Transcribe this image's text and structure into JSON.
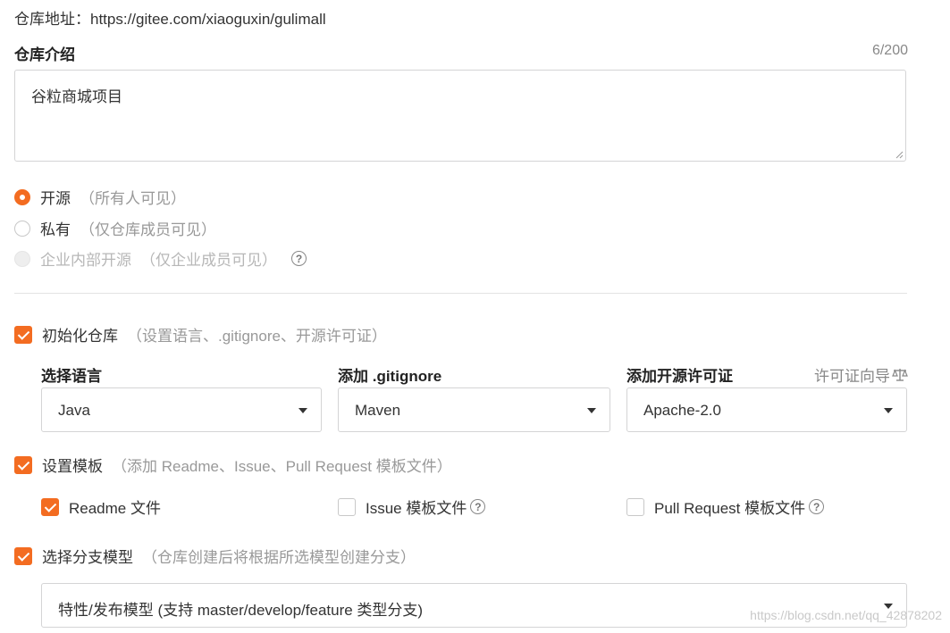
{
  "repo": {
    "address_label": "仓库地址：",
    "address_value": "https://gitee.com/xiaoguxin/gulimall"
  },
  "description": {
    "label": "仓库介绍",
    "count": "6/200",
    "value": "谷粒商城项目"
  },
  "visibility": {
    "options": [
      {
        "label": "开源",
        "hint": "（所有人可见）",
        "checked": true,
        "disabled": false
      },
      {
        "label": "私有",
        "hint": "（仅仓库成员可见）",
        "checked": false,
        "disabled": false
      },
      {
        "label": "企业内部开源",
        "hint": "（仅企业成员可见）",
        "checked": false,
        "disabled": true
      }
    ]
  },
  "init_repo": {
    "label": "初始化仓库",
    "hint": "（设置语言、.gitignore、开源许可证）",
    "checked": true
  },
  "selects": {
    "language": {
      "label": "选择语言",
      "value": "Java"
    },
    "gitignore": {
      "label": "添加 .gitignore",
      "value": "Maven"
    },
    "license": {
      "label": "添加开源许可证",
      "value": "Apache-2.0",
      "guide": "许可证向导"
    }
  },
  "template": {
    "label": "设置模板",
    "hint": "（添加 Readme、Issue、Pull Request 模板文件）",
    "checked": true,
    "options": [
      {
        "label": "Readme 文件",
        "checked": true
      },
      {
        "label": "Issue 模板文件",
        "checked": false
      },
      {
        "label": "Pull Request 模板文件",
        "checked": false
      }
    ]
  },
  "branch_model": {
    "label": "选择分支模型",
    "hint": "（仓库创建后将根据所选模型创建分支）",
    "checked": true,
    "value": "特性/发布模型 (支持 master/develop/feature 类型分支)"
  },
  "watermark": "https://blog.csdn.net/qq_42878202",
  "colors": {
    "accent": "#f36c21",
    "border": "#d4d4d5",
    "hint": "#999999"
  },
  "icons": {
    "help": "question-circle-icon",
    "caret": "caret-down-icon",
    "guide": "scale-icon"
  }
}
